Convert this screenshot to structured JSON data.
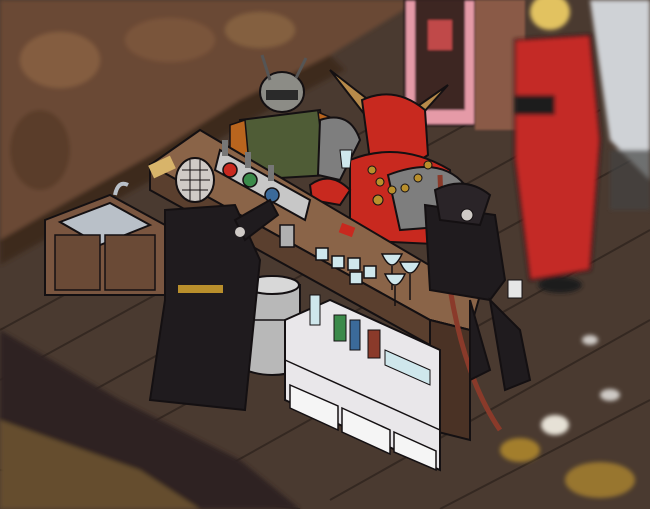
{
  "scene": {
    "kind": "isometric cartoon tavern interior",
    "palette": {
      "floor": "#4a3a30",
      "floor_plank": "#3a2c24",
      "rock_wall": "#6b4a34",
      "rock_dark": "#3e2a1e",
      "bar_top": "#8a6448",
      "bar_front": "#5a3f2e",
      "cabinet": "#e9e7ea",
      "counter": "#7a5640",
      "sink": "#b9c0c8",
      "keg": "#b8b8b8",
      "demon_red": "#c8291f",
      "horn": "#b78a4a",
      "armor": "#7e7e7e",
      "robe_black": "#1f1b1e",
      "robe_red": "#c42a27",
      "hair_blonde": "#e2c260",
      "military_green": "#4f5c36",
      "orange_suit": "#b9651e",
      "door_pink": "#e59aa7",
      "glass": "#cfe7ec",
      "gold": "#b98f2c",
      "outline": "#141012"
    },
    "characters": [
      {
        "id": "pinhead",
        "icon": "pinhead-figure"
      },
      {
        "id": "red-demon",
        "icon": "horned-demon-figure"
      },
      {
        "id": "soldier",
        "icon": "masked-soldier-figure"
      },
      {
        "id": "reaper",
        "icon": "hooded-reaper-figure"
      },
      {
        "id": "red-coat",
        "icon": "red-coat-figure"
      }
    ]
  }
}
